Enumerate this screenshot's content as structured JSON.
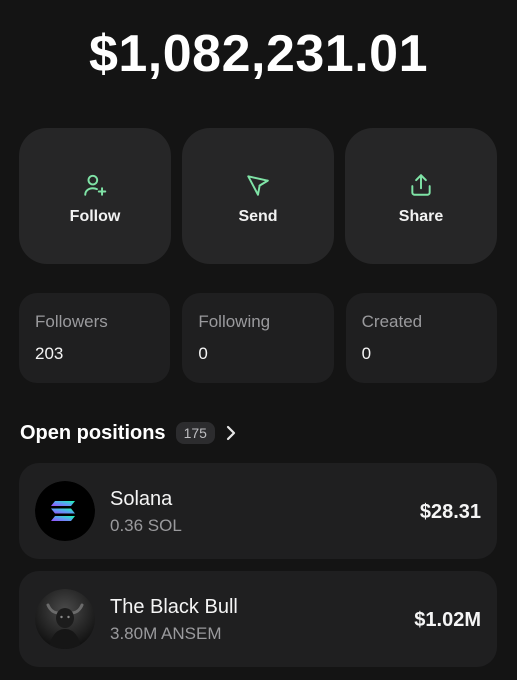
{
  "balance": "$1,082,231.01",
  "actions": [
    {
      "label": "Follow",
      "icon": "add-user-icon"
    },
    {
      "label": "Send",
      "icon": "send-icon"
    },
    {
      "label": "Share",
      "icon": "share-icon"
    }
  ],
  "stats": [
    {
      "label": "Followers",
      "value": "203"
    },
    {
      "label": "Following",
      "value": "0"
    },
    {
      "label": "Created",
      "value": "0"
    }
  ],
  "positions_section": {
    "title": "Open positions",
    "count": "175"
  },
  "positions": [
    {
      "name": "Solana",
      "amount": "0.36 SOL",
      "value": "$28.31",
      "icon": "solana-logo"
    },
    {
      "name": "The Black Bull",
      "amount": "3.80M ANSEM",
      "value": "$1.02M",
      "icon": "black-bull-avatar"
    }
  ],
  "colors": {
    "background": "#141414",
    "card": "#262627",
    "card_muted": "#1f1f20",
    "accent_green": "#7fe3a6",
    "muted_text": "#9a9a9d"
  }
}
